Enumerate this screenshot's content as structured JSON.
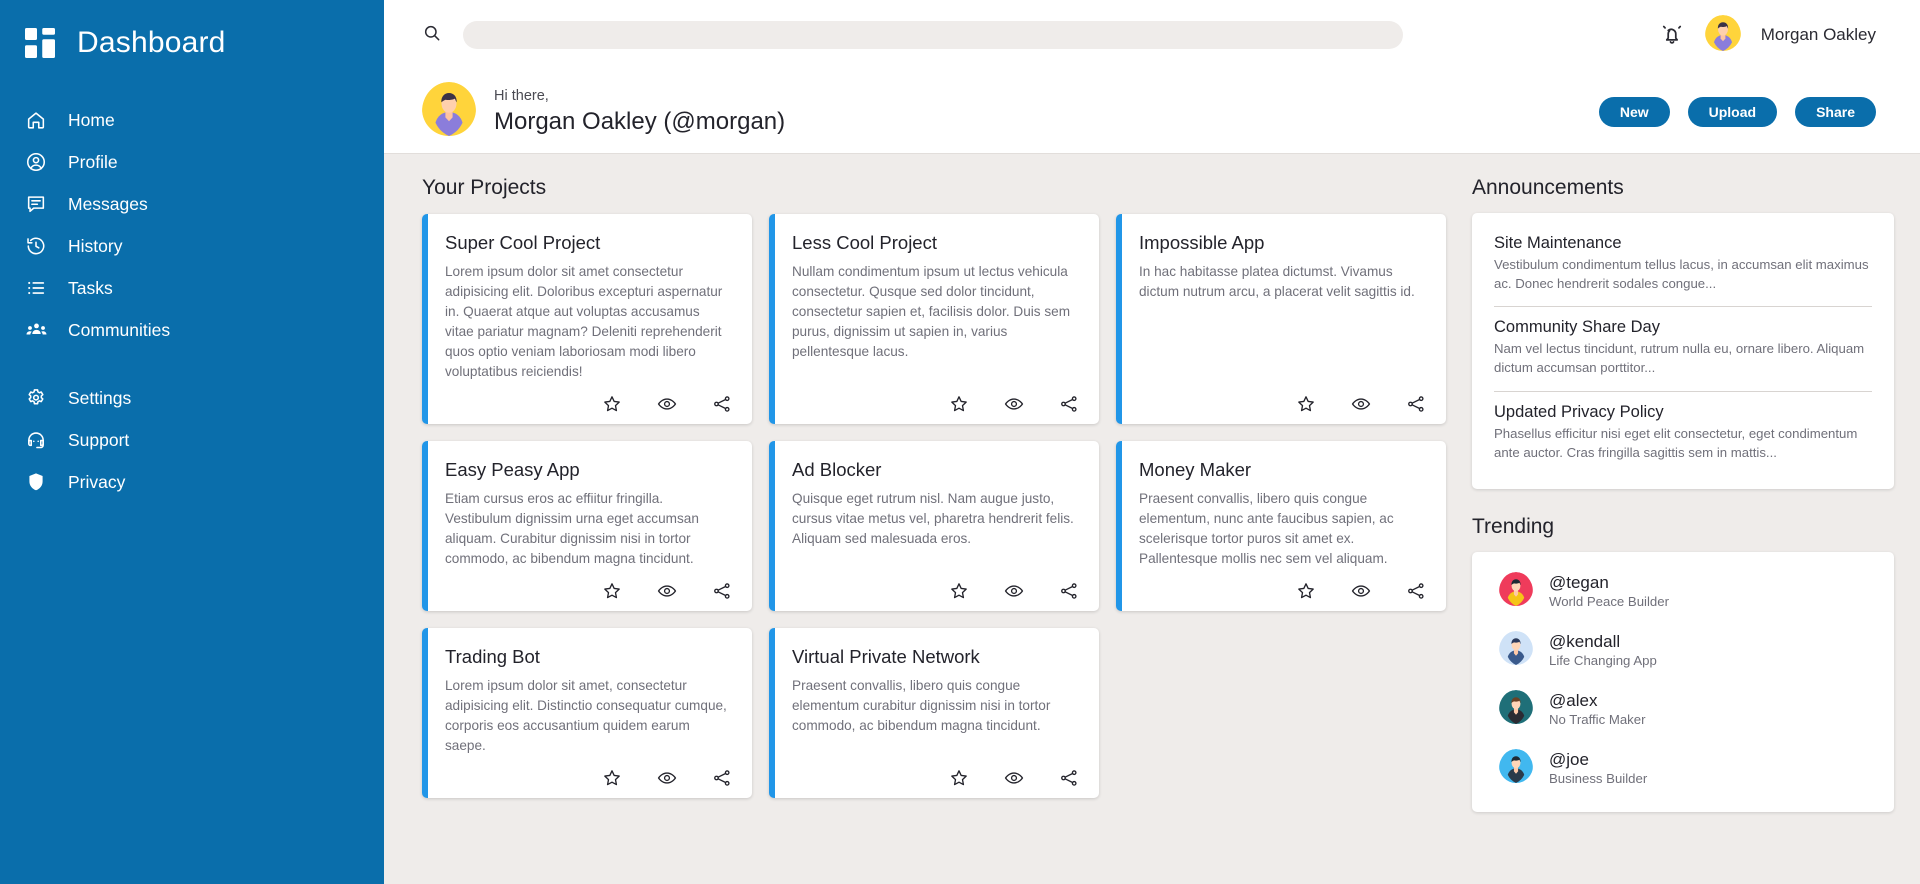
{
  "brand": {
    "title": "Dashboard",
    "logo_icon": "grid-logo-icon",
    "color": "#0a6eab"
  },
  "sidebar": {
    "items": [
      {
        "label": "Home",
        "icon": "home-icon"
      },
      {
        "label": "Profile",
        "icon": "user-circle-icon"
      },
      {
        "label": "Messages",
        "icon": "chat-bubble-icon"
      },
      {
        "label": "History",
        "icon": "history-clock-icon"
      },
      {
        "label": "Tasks",
        "icon": "list-icon"
      },
      {
        "label": "Communities",
        "icon": "people-group-icon"
      }
    ],
    "items_secondary": [
      {
        "label": "Settings",
        "icon": "gear-icon"
      },
      {
        "label": "Support",
        "icon": "support-headset-icon"
      },
      {
        "label": "Privacy",
        "icon": "shield-icon"
      }
    ]
  },
  "topbar": {
    "search_placeholder": "",
    "search_value": "",
    "search_icon": "search-icon",
    "bell_icon": "notification-bell-icon",
    "user_name": "Morgan Oakley",
    "avatar_icon": "user-avatar"
  },
  "greeting": {
    "hi": "Hi there,",
    "name": "Morgan Oakley (@morgan)",
    "avatar_icon": "user-avatar-large",
    "actions": [
      {
        "label": "New"
      },
      {
        "label": "Upload"
      },
      {
        "label": "Share"
      }
    ]
  },
  "projects": {
    "heading": "Your Projects",
    "accent_color": "#2196e8",
    "card_actions": [
      {
        "icon": "star-icon",
        "label": "Favorite"
      },
      {
        "icon": "eye-icon",
        "label": "View"
      },
      {
        "icon": "share-icon",
        "label": "Share"
      }
    ],
    "items": [
      {
        "title": "Super Cool Project",
        "body": "Lorem ipsum dolor sit amet consectetur adipisicing elit. Doloribus excepturi aspernatur in. Quaerat atque aut voluptas accusamus vitae pariatur magnam? Deleniti reprehenderit quos optio veniam laboriosam modi libero voluptatibus reiciendis!"
      },
      {
        "title": "Less Cool Project",
        "body": "Nullam condimentum ipsum ut lectus vehicula consectetur. Qusque sed dolor tincidunt, consectetur sapien et, facilisis dolor. Duis sem purus, dignissim ut sapien in, varius pellentesque lacus."
      },
      {
        "title": "Impossible App",
        "body": "In hac habitasse platea dictumst. Vivamus dictum nutrum arcu, a placerat velit sagittis id."
      },
      {
        "title": "Easy Peasy App",
        "body": "Etiam cursus eros ac effiitur fringilla. Vestibulum dignissim urna eget accumsan aliquam. Curabitur dignissim nisi in tortor commodo, ac bibendum magna tincidunt."
      },
      {
        "title": "Ad Blocker",
        "body": "Quisque eget rutrum nisl. Nam augue justo, cursus vitae metus vel, pharetra hendrerit felis. Aliquam sed malesuada eros."
      },
      {
        "title": "Money Maker",
        "body": "Praesent convallis, libero quis congue elementum, nunc ante faucibus sapien, ac scelerisque tortor puros sit amet ex. Pallentesque mollis nec sem vel aliquam."
      },
      {
        "title": "Trading Bot",
        "body": "Lorem ipsum dolor sit amet, consectetur adipisicing elit. Distinctio consequatur cumque, corporis eos accusantium quidem earum saepe."
      },
      {
        "title": "Virtual Private Network",
        "body": "Praesent convallis, libero quis congue elementum curabitur dignissim nisi in tortor commodo, ac bibendum magna tincidunt."
      }
    ]
  },
  "announcements": {
    "heading": "Announcements",
    "items": [
      {
        "title": "Site Maintenance",
        "text": "Vestibulum condimentum tellus lacus, in accumsan elit maximus ac. Donec hendrerit sodales congue..."
      },
      {
        "title": "Community Share Day",
        "text": "Nam vel lectus tincidunt, rutrum nulla eu, ornare libero. Aliquam dictum accumsan porttitor..."
      },
      {
        "title": "Updated Privacy Policy",
        "text": "Phasellus efficitur nisi eget elit consectetur, eget condimentum ante auctor. Cras fringilla sagittis sem in mattis..."
      }
    ]
  },
  "trending": {
    "heading": "Trending",
    "items": [
      {
        "handle": "@tegan",
        "sub": "World Peace Builder",
        "avatar_bg": "#ef3b5b",
        "hair": "#1f2933",
        "shirt": "#f5c518"
      },
      {
        "handle": "@kendall",
        "sub": "Life Changing App",
        "avatar_bg": "#cfe2f7",
        "hair": "#2b3a5c",
        "shirt": "#3a5a8c"
      },
      {
        "handle": "@alex",
        "sub": "No Traffic Maker",
        "avatar_bg": "#1f6f78",
        "hair": "#6b4226",
        "shirt": "#2b2b33"
      },
      {
        "handle": "@joe",
        "sub": "Business Builder",
        "avatar_bg": "#41b8ef",
        "hair": "#1f2933",
        "shirt": "#2b3a4a"
      }
    ]
  }
}
